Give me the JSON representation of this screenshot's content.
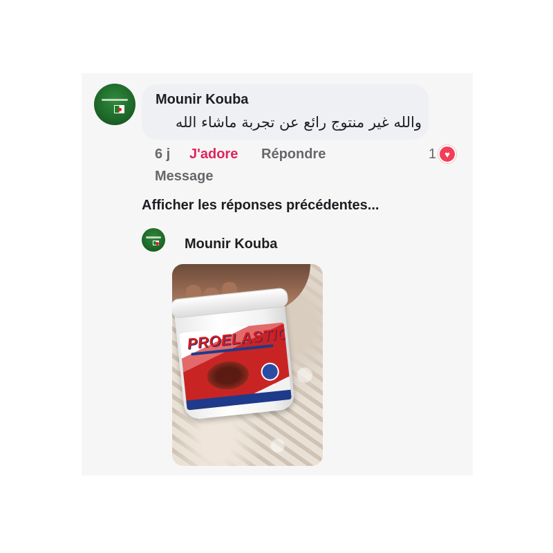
{
  "comment": {
    "author": "Mounir Kouba",
    "text": "والله غير منتوج رائع عن تجربة ماشاء الله",
    "time": "6 j",
    "like_label": "J'adore",
    "reply_label": "Répondre",
    "message_label": "Message",
    "reaction_count": "1",
    "reaction_icon": "heart-icon",
    "like_color": "#e0245e"
  },
  "thread": {
    "previous_replies_label": "Afficher les réponses précédentes..."
  },
  "reply": {
    "author": "Mounir Kouba",
    "photo": {
      "brand_text": "PROELASTIC"
    }
  }
}
